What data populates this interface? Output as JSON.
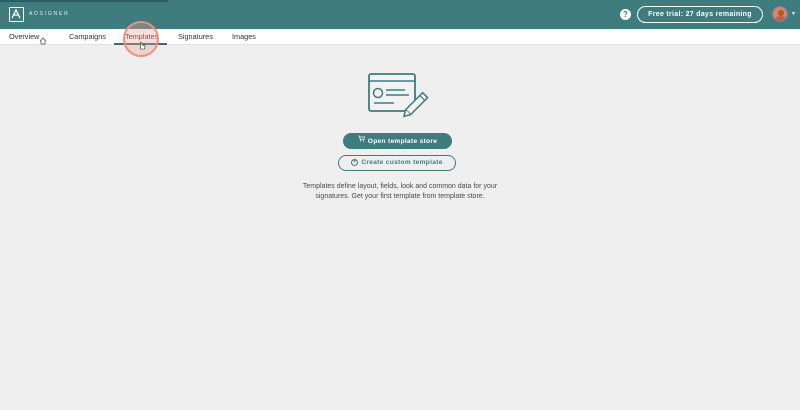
{
  "header": {
    "logo_text": "ADSIGNER",
    "help_icon": "question-circle-icon",
    "trial_label": "Free trial: 27 days remaining",
    "avatar_icon": "user-avatar",
    "caret_icon": "chevron-down-icon"
  },
  "nav": {
    "items": [
      {
        "label": "Overview",
        "icon": "home-icon"
      },
      {
        "label": "Campaigns"
      },
      {
        "label": "Templates",
        "active": true
      },
      {
        "label": "Signatures"
      },
      {
        "label": "Images"
      }
    ]
  },
  "empty_state": {
    "illustration_icon": "template-pencil-illustration",
    "primary_button": {
      "label": "Open template store",
      "icon": "cart-icon"
    },
    "secondary_button": {
      "label": "Create custom template",
      "icon": "plus-circle-icon"
    },
    "description": "Templates define layout, fields, look and common data for your signatures. Get your first template from template store."
  },
  "colors": {
    "header_bg": "#3f7c7e",
    "accent": "#3f7c7e",
    "page_bg": "#efefef",
    "cursor_highlight": "#ef8f84"
  }
}
